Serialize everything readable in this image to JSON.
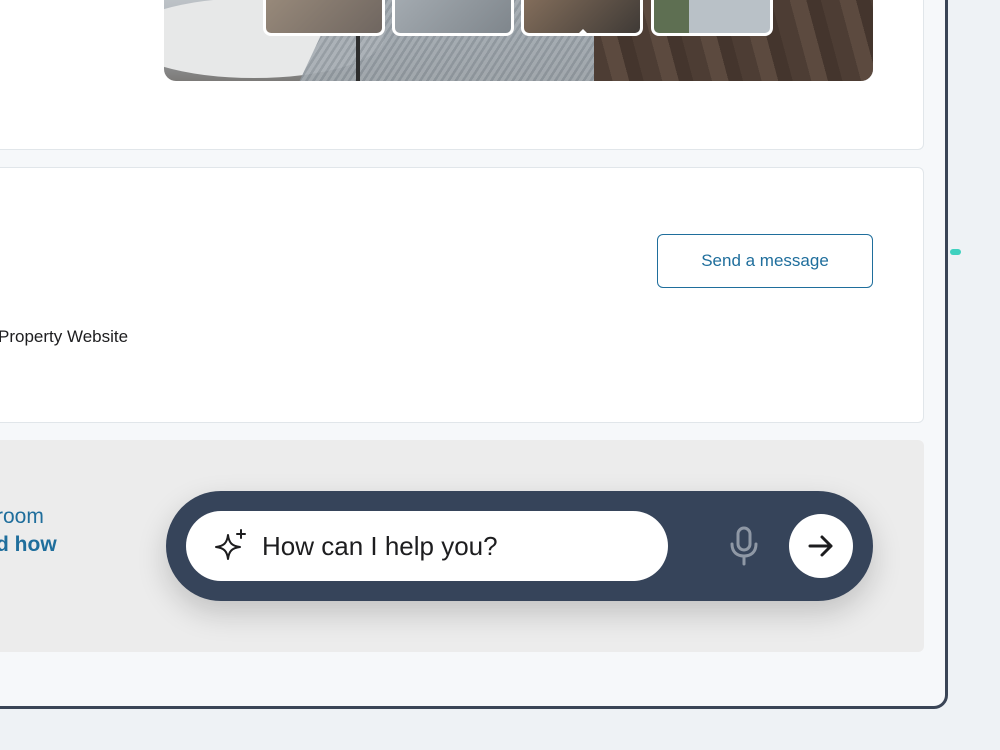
{
  "agent": {
    "send_label": "Send a message",
    "website_label": "Property Website"
  },
  "chat_promo": {
    "line1": "room",
    "line2": "d how"
  },
  "assistant": {
    "placeholder": "How can I help you?",
    "sparkle_icon": "sparkle-icon",
    "mic_icon": "microphone-icon",
    "send_icon": "arrow-right-icon"
  },
  "colors": {
    "accent": "#1f6e9c",
    "assistant_bar": "#36445a",
    "indicator": "#3fd1bf"
  }
}
